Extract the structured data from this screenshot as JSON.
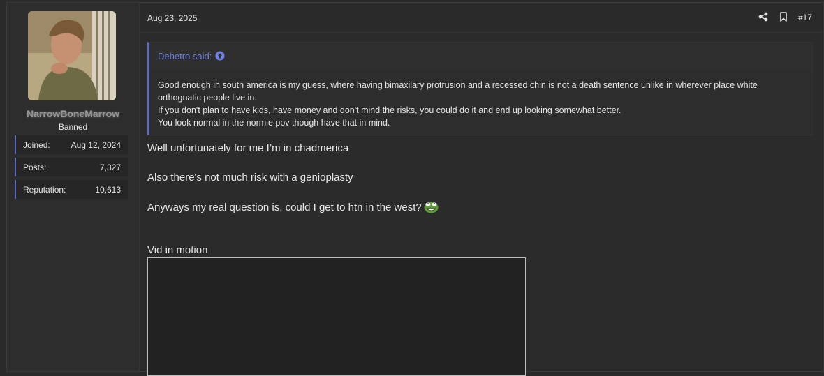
{
  "user": {
    "username": "NarrowBoneMarrow",
    "title": "Banned",
    "stats": [
      {
        "label": "Joined:",
        "value": "Aug 12, 2024"
      },
      {
        "label": "Posts:",
        "value": "7,327"
      },
      {
        "label": "Reputation:",
        "value": "10,613"
      }
    ]
  },
  "post": {
    "date": "Aug 23, 2025",
    "number": "#17",
    "quote": {
      "author": "Debetro said:",
      "lines": [
        "Good enough in south america is my guess, where having bimaxilary protrusion and a recessed chin is not a death sentence unlike in wherever place white orthognatic people live in.",
        "If you don't plan to have kids, have money and don't mind the risks, you could do it and end up looking somewhat better.",
        "You look normal in the normie pov though have that in mind."
      ]
    },
    "body": {
      "p1": "Well unfortunately for me I’m in chadmerica",
      "p2": "Also there's not much risk with a genioplasty",
      "p3": "Anyways my real question is, could I get to htn in the west?",
      "p4": "Vid in motion"
    },
    "icons": {
      "share": "share-icon",
      "bookmark": "bookmark-icon",
      "quote_up": "arrow-up-circle-icon",
      "emoji": "laughing-pepe-emoji-icon"
    }
  },
  "colors": {
    "accent": "#5c6bc0",
    "link": "#6f7fe0",
    "background": "#2b2b2b"
  }
}
